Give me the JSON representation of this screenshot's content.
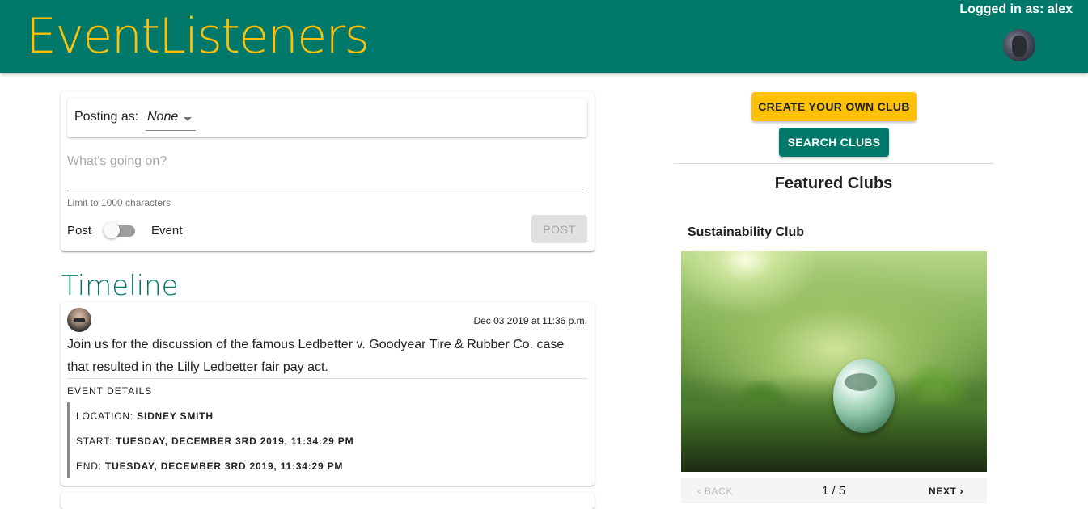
{
  "header": {
    "brand": "EventListeners",
    "login_text": "Logged in as: alex"
  },
  "composer": {
    "posting_as_label": "Posting as:",
    "posting_as_value": "None",
    "placeholder": "What's going on?",
    "helper": "Limit to 1000 characters",
    "toggle_left": "Post",
    "toggle_right": "Event",
    "toggle_on": false,
    "post_button": "POST"
  },
  "timeline": {
    "title": "Timeline",
    "posts": [
      {
        "date": "Dec 03 2019 at 11:36 p.m.",
        "body": "Join us for the discussion of the famous Ledbetter v. Goodyear Tire & Rubber Co. case that resulted in the Lilly Ledbetter fair pay act.",
        "event_header": "EVENT DETAILS",
        "location_label": "LOCATION:",
        "location_value": "SIDNEY SMITH",
        "start_label": "START:",
        "start_value": "TUESDAY, DECEMBER 3RD 2019, 11:34:29 PM",
        "end_label": "END:",
        "end_value": "TUESDAY, DECEMBER 3RD 2019, 11:34:29 PM"
      }
    ]
  },
  "sidebar": {
    "create_button": "CREATE YOUR OWN CLUB",
    "search_button": "SEARCH CLUBS",
    "featured_title": "Featured Clubs",
    "club_name": "Sustainability Club",
    "stepper": {
      "back": "BACK",
      "count": "1 / 5",
      "next": "NEXT"
    }
  },
  "colors": {
    "primary": "#00796b",
    "accent": "#ffc107"
  }
}
